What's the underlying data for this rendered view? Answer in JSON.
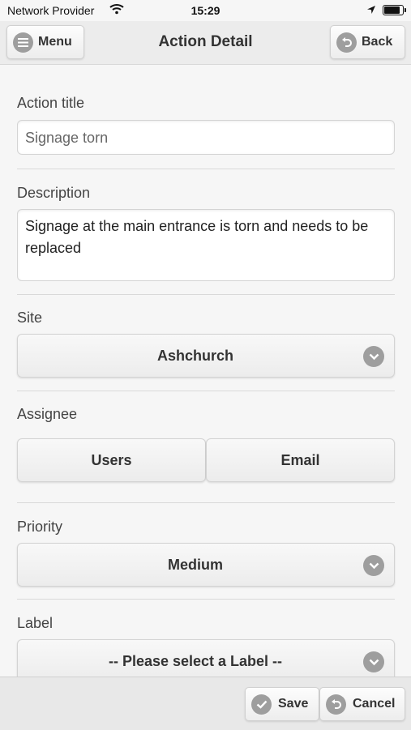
{
  "status_bar": {
    "carrier": "Network Provider",
    "time": "15:29",
    "icons": [
      "wifi-icon",
      "location-arrow-icon",
      "battery-icon"
    ]
  },
  "header": {
    "title": "Action Detail",
    "menu_label": "Menu",
    "back_label": "Back",
    "menu_icon": "hamburger-icon",
    "back_icon": "back-arrow-icon"
  },
  "form": {
    "action_title": {
      "label": "Action title",
      "placeholder": "Signage torn",
      "value": ""
    },
    "description": {
      "label": "Description",
      "value": "Signage at the main entrance is torn and needs to be replaced"
    },
    "site": {
      "label": "Site",
      "value": "Ashchurch"
    },
    "assignee": {
      "label": "Assignee",
      "options": [
        "Users",
        "Email"
      ]
    },
    "priority": {
      "label": "Priority",
      "value": "Medium"
    },
    "label_field": {
      "label": "Label",
      "value": "-- Please select a Label --"
    }
  },
  "footer": {
    "save_label": "Save",
    "cancel_label": "Cancel",
    "save_icon": "check-icon",
    "cancel_icon": "undo-icon"
  },
  "colors": {
    "icon_circle": "#9e9e9e",
    "background": "#f6f6f6",
    "header": "#ececec"
  }
}
